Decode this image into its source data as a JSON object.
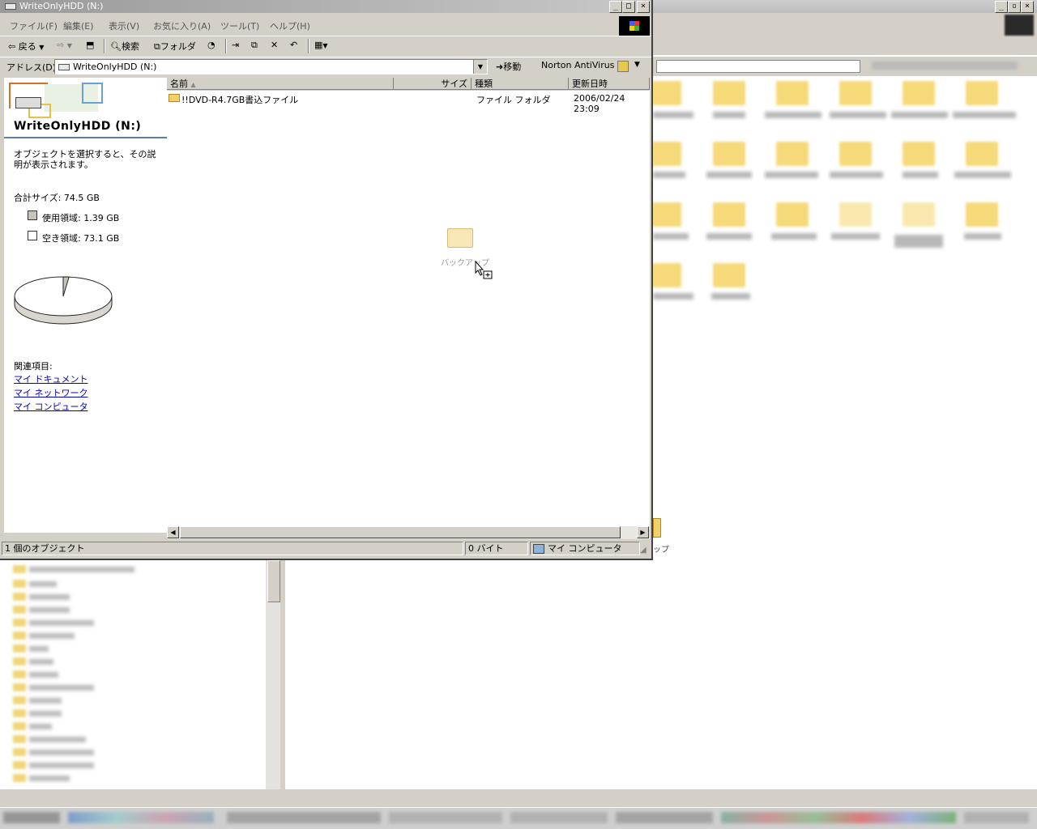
{
  "window": {
    "title": "WriteOnlyHDD (N:)",
    "controls": {
      "minimize": "_",
      "maximize": "□",
      "close": "×"
    }
  },
  "menu": [
    "ファイル(F)",
    "編集(E)",
    "表示(V)",
    "お気に入り(A)",
    "ツール(T)",
    "ヘルプ(H)"
  ],
  "toolbar": {
    "back": "戻る",
    "search": "検索",
    "folders": "フォルダ"
  },
  "address": {
    "label": "アドレス(D)",
    "value": "WriteOnlyHDD (N:)",
    "go": "移動",
    "norton": "Norton AntiVirus"
  },
  "task_pane": {
    "title": "WriteOnlyHDD (N:)",
    "description": "オブジェクトを選択すると、その説明が表示されます。",
    "total_size": "合計サイズ: 74.5 GB",
    "used": "使用領域: 1.39 GB",
    "free": "空き領域: 73.1 GB",
    "used_fraction": 0.019,
    "related_title": "関連項目:",
    "related_links": [
      "マイ ドキュメント",
      "マイ ネットワーク",
      "マイ コンピュータ"
    ]
  },
  "file_list": {
    "columns": [
      "名前",
      "サイズ",
      "種類",
      "更新日時"
    ],
    "rows": [
      {
        "name": "!!DVD-R4.7GB書込ファイル",
        "size": "",
        "type": "ファイル フォルダ",
        "modified": "2006/02/24 23:09"
      }
    ],
    "drag_label": "バックアップ"
  },
  "status": {
    "objects": "1 個のオブジェクト",
    "bytes": "0 バイト",
    "location": "マイ コンピュータ"
  },
  "background": {
    "partial_label": "ップ"
  },
  "colors": {
    "link": "#0000cc",
    "folder": "#f0d067",
    "chrome": "#d4d0c8"
  }
}
